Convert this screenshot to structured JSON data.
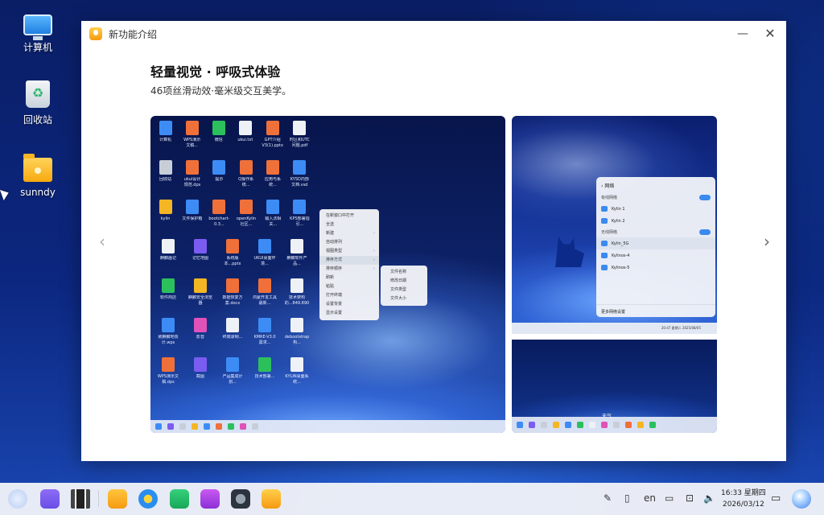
{
  "desktop": {
    "icons": [
      {
        "label": "计算机",
        "icon": "computer-icon"
      },
      {
        "label": "回收站",
        "icon": "trash-icon"
      },
      {
        "label": "sunndy",
        "icon": "folder-icon"
      }
    ]
  },
  "window": {
    "title": "新功能介绍",
    "minimize": "—",
    "close": "✕",
    "heading": "轻量视觉 · 呼吸式体验",
    "subheading": "46项丝滑动效·毫米级交互美学。",
    "prev": "‹",
    "next": "›"
  },
  "preview_main": {
    "rows": [
      [
        "计算机",
        "WPS演示文稿...",
        "微信",
        "ukui.txt",
        "GPT介绍V3(1).pptx",
        "时区和UTC问题.pdf"
      ],
      [
        "回收站",
        "ukui设计规范.dps",
        "提示",
        "Q操作系统...",
        "应用与系统...",
        "KYSD内部文档.vsd"
      ],
      [
        "kylin",
        "文件保护箱",
        "bootchart-0.3...",
        "openKylin社区...",
        "输入法相关...",
        "KPS部署指引..."
      ],
      [
        "麒麟画记",
        "记忆地图",
        "系统版本...pptx",
        "UKUI桌面环境...",
        "麒麟软件产品..."
      ],
      [
        "软件商店",
        "麒麟安全浏览器",
        "数据恢复方案.docx",
        "鸿蒙开发工具最新...",
        "技术架构的...849.890"
      ],
      [
        "致麒麟地铁计.wps",
        "影音",
        "终端录制...",
        "KMRE-V3.0需求...",
        "debootstrap构..."
      ],
      [
        "WPS演示文稿.dps",
        "截图",
        "产品集成计划...",
        "技术部署...",
        "KYLIN桌面系统..."
      ]
    ],
    "menu": [
      "在新窗口中打开",
      "全选",
      "新建",
      "自动排列",
      "视图类型",
      "排序方式",
      "排序顺序",
      "刷新",
      "粘贴",
      "打开终端",
      "设置背景",
      "显示设置"
    ],
    "submenu": [
      "文件名称",
      "修改日期",
      "文件类型",
      "文件大小"
    ]
  },
  "preview_network": {
    "title": "网络",
    "wired": "有线网络",
    "wired_items": [
      "Kylin 1",
      "Kylin 2"
    ],
    "wireless": "无线网络",
    "wireless_items": [
      "Kylin_5G",
      "Kylinos-4",
      "Kylinos-5"
    ],
    "more": "更多网络设置",
    "clock": "20:47 星期二 2025/08/05"
  },
  "preview_bottom": {
    "label": "天气"
  },
  "taskbar": {
    "lang": "en",
    "time": "16:33 星期四",
    "date": "2026/03/12",
    "apps": [
      "kylin-start-icon",
      "search-icon",
      "multitask-icon",
      "file-manager-icon",
      "browser-icon",
      "software-store-icon",
      "camera-icon",
      "settings-icon",
      "new-features-icon"
    ]
  }
}
